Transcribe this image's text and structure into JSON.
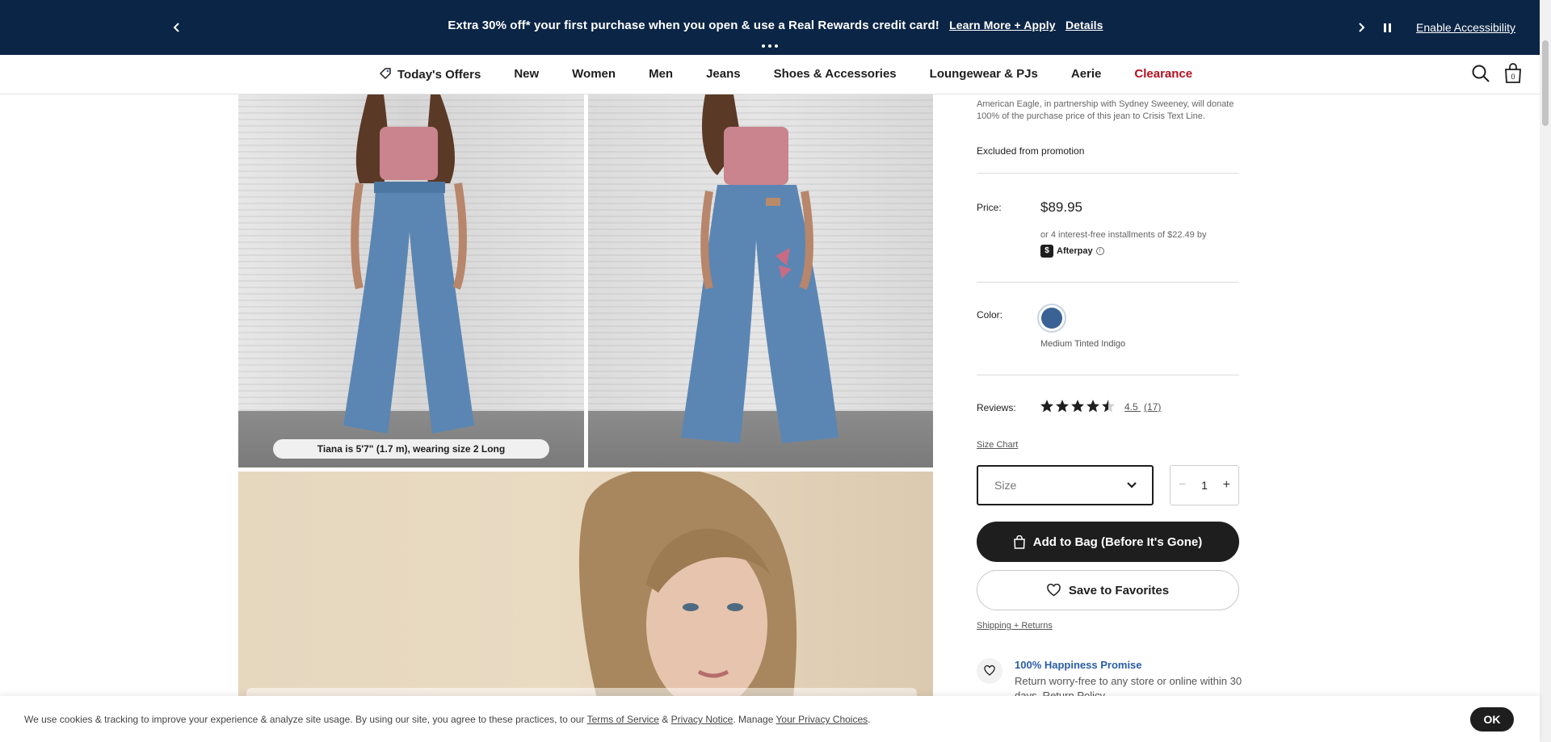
{
  "promo": {
    "message": "Extra 30% off* your first purchase when you open & use a Real Rewards credit card!",
    "learn_more": "Learn More + Apply",
    "details": "Details",
    "accessibility": "Enable Accessibility"
  },
  "nav": {
    "items": [
      "Today's Offers",
      "New",
      "Women",
      "Men",
      "Jeans",
      "Shoes & Accessories",
      "Loungewear & PJs",
      "Aerie",
      "Clearance"
    ],
    "bag_count": "0",
    "clearance_color": "#b50e1f"
  },
  "gallery": {
    "model_caption": "Tiana is 5'7\" (1.7 m), wearing size 2 Long"
  },
  "product": {
    "donation_text": "American Eagle, in partnership with Sydney Sweeney, will donate 100% of the purchase price of this jean to Crisis Text Line.",
    "excluded": "Excluded from promotion",
    "price_label": "Price:",
    "price": "$89.95",
    "installments": "or 4 interest-free installments of $22.49 by",
    "afterpay": "Afterpay",
    "color_label": "Color:",
    "color_name": "Medium Tinted Indigo",
    "color_hex": "#3a6294",
    "reviews_label": "Reviews:",
    "rating_value": 4.5,
    "rating_text": "4.5",
    "review_count": "(17)",
    "size_chart": "Size Chart",
    "size_placeholder": "Size",
    "quantity": "1",
    "add_to_bag": "Add to Bag (Before It's Gone)",
    "save_favorites": "Save to Favorites",
    "shipping_returns": "Shipping + Returns",
    "promise_title": "100% Happiness Promise",
    "promise_text": "Return worry-free to any store or online within 30 days. Return Policy"
  },
  "cookie": {
    "text_before": "We use cookies & tracking to improve your experience & analyze site usage. By using our site, you agree to these practices, to our",
    "terms": "Terms of Service",
    "amp": "&",
    "privacy": "Privacy Notice",
    "manage": ". Manage",
    "choices": "Your Privacy Choices",
    "ok": "OK"
  },
  "colors": {
    "banner_bg": "#0b2546",
    "primary_button": "#1e1e1e",
    "link_blue": "#2a5da8"
  }
}
